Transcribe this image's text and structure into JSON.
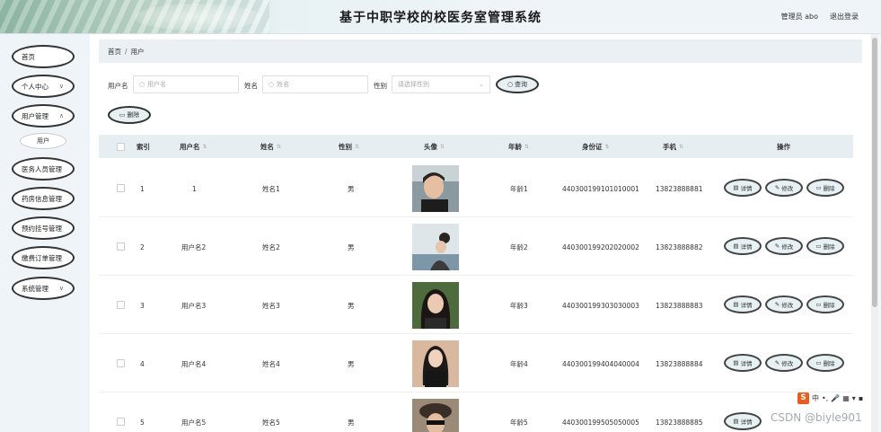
{
  "header": {
    "title": "基于中职学校的校医务室管理系统",
    "user_label": "管理员 abo",
    "logout_label": "退出登录"
  },
  "sidebar": {
    "items": [
      {
        "label": "首页"
      },
      {
        "label": "个人中心"
      },
      {
        "label": "用户管理"
      },
      {
        "label": "用户"
      },
      {
        "label": "医务人员管理"
      },
      {
        "label": "药房信息管理"
      },
      {
        "label": "预约挂号管理"
      },
      {
        "label": "缴费订单管理"
      },
      {
        "label": "系统管理"
      }
    ]
  },
  "breadcrumb": {
    "home": "首页",
    "sep": "/",
    "current": "用户"
  },
  "search": {
    "username_label": "用户名",
    "username_placeholder": "用户名",
    "name_label": "姓名",
    "name_placeholder": "姓名",
    "gender_label": "性别",
    "gender_placeholder": "请选择性别",
    "query_label": "查询",
    "delete_label": "删除"
  },
  "table": {
    "headers": [
      "索引",
      "用户名",
      "姓名",
      "性别",
      "头像",
      "年龄",
      "身份证",
      "手机",
      "操作"
    ],
    "actions": {
      "detail": "详情",
      "edit": "修改",
      "delete": "删除"
    },
    "rows": [
      {
        "index": "1",
        "username": "1",
        "name": "姓名1",
        "gender": "男",
        "age": "年龄1",
        "idcard": "440300199101010001",
        "phone": "13823888881"
      },
      {
        "index": "2",
        "username": "用户名2",
        "name": "姓名2",
        "gender": "男",
        "age": "年龄2",
        "idcard": "440300199202020002",
        "phone": "13823888882"
      },
      {
        "index": "3",
        "username": "用户名3",
        "name": "姓名3",
        "gender": "男",
        "age": "年龄3",
        "idcard": "440300199303030003",
        "phone": "13823888883"
      },
      {
        "index": "4",
        "username": "用户名4",
        "name": "姓名4",
        "gender": "男",
        "age": "年龄4",
        "idcard": "440300199404040004",
        "phone": "13823888884"
      },
      {
        "index": "5",
        "username": "用户名5",
        "name": "姓名5",
        "gender": "男",
        "age": "年龄5",
        "idcard": "440300199505050005",
        "phone": "13823888885"
      }
    ]
  },
  "watermark": "CSDN @biyle901",
  "ime": {
    "badge": "S",
    "label": "中"
  }
}
